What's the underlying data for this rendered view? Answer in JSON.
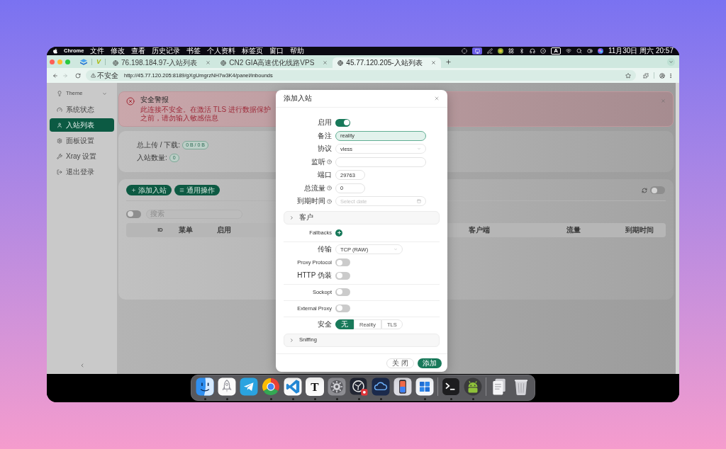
{
  "menu_bar": {
    "app_name": "Chrome",
    "menus": [
      "文件",
      "修改",
      "查看",
      "历史记录",
      "书签",
      "个人资料",
      "标签页",
      "窗口",
      "帮助"
    ],
    "input_indicator": "A",
    "clock": "11月30日 周六 20:57"
  },
  "browser": {
    "pinned_logo": "V",
    "tabs": [
      {
        "title": "76.198.184.97-入站列表",
        "selected": false
      },
      {
        "title": "CN2 GIA高速优化线路VPS",
        "selected": false
      },
      {
        "title": "45.77.120.205-入站列表",
        "selected": true
      }
    ],
    "security_label": "不安全",
    "url": "http://45.77.120.205:8189/gXgUmgrzNH7w3K4/panel/inbounds"
  },
  "sidebar": {
    "theme_label": "Theme",
    "items": [
      {
        "label": "系统状态",
        "selected": false
      },
      {
        "label": "入站列表",
        "selected": true
      },
      {
        "label": "面板设置",
        "selected": false
      },
      {
        "label": "Xray 设置",
        "selected": false
      },
      {
        "label": "退出登录",
        "selected": false
      }
    ]
  },
  "alert": {
    "title": "安全警报",
    "message": "此连接不安全。在激活 TLS 进行数据保护之前，请勿输入敏感信息"
  },
  "stats": [
    {
      "label": "总上传 / 下载:",
      "value": "0 B / 0 B"
    },
    {
      "label": "入站数量:",
      "value": "0"
    }
  ],
  "inbounds": {
    "buttons": [
      "添加入站",
      "通用操作"
    ],
    "auto_refresh": {
      "on": false
    },
    "filter_toggle": {
      "on": false
    },
    "search": {
      "placeholder": "搜索"
    },
    "table": {
      "columns": [
        "ID",
        "菜单",
        "启用",
        "客户端",
        "流量",
        "到期时间"
      ]
    }
  },
  "modal": {
    "title": "添加入站",
    "fields": [
      {
        "label": "启用",
        "kind": "switch",
        "on": true,
        "help": false
      },
      {
        "label": "备注",
        "kind": "text",
        "value": "reality",
        "focused": true,
        "help": false
      },
      {
        "label": "协议",
        "kind": "select",
        "value": "vless",
        "help": false
      },
      {
        "label": "监听",
        "kind": "text",
        "focused": false,
        "help": true
      },
      {
        "label": "端口",
        "kind": "number",
        "value": "29763",
        "focused": false,
        "help": false
      },
      {
        "label": "总流量",
        "kind": "number",
        "value": "0",
        "focused": false,
        "help": true
      },
      {
        "label": "到期时间",
        "kind": "date",
        "placeholder": "Select date",
        "help": true
      }
    ],
    "clients_panel": {
      "label": "客户",
      "expanded": false
    },
    "fallbacks": {
      "label": "Fallbacks"
    },
    "stream_groups": [
      {
        "fields": [
          {
            "label": "传输",
            "kind": "select",
            "value": "TCP (RAW)"
          },
          {
            "label": "Proxy Protocol",
            "kind": "switch",
            "on": false
          },
          {
            "label": "HTTP 伪装",
            "kind": "switch",
            "on": false
          }
        ]
      },
      {
        "fields": [
          {
            "label": "Sockopt",
            "kind": "switch",
            "on": false
          }
        ]
      },
      {
        "fields": [
          {
            "label": "External Proxy",
            "kind": "switch",
            "on": false
          }
        ]
      },
      {
        "fields": [
          {
            "label": "安全",
            "kind": "segmented",
            "options": [
              {
                "label": "无",
                "selected": true
              },
              {
                "label": "Reality",
                "selected": false
              },
              {
                "label": "TLS",
                "selected": false
              }
            ]
          }
        ]
      }
    ],
    "sniffing_panel": {
      "label": "Sniffing",
      "expanded": false
    },
    "buttons": [
      {
        "label": "关 闭",
        "kind": "default"
      },
      {
        "label": "添加",
        "kind": "primary"
      }
    ]
  },
  "dock": {
    "apps": [
      {
        "running": true
      },
      {
        "running": true
      },
      {
        "running": false
      },
      {
        "running": true
      },
      {
        "running": true
      },
      {
        "label": "T",
        "running": true
      },
      {
        "running": true
      },
      {
        "running": true
      },
      {
        "running": true
      },
      {
        "running": false
      },
      {
        "running": true
      }
    ],
    "utilities": [
      {
        "running": true
      },
      {
        "running": true
      }
    ]
  }
}
